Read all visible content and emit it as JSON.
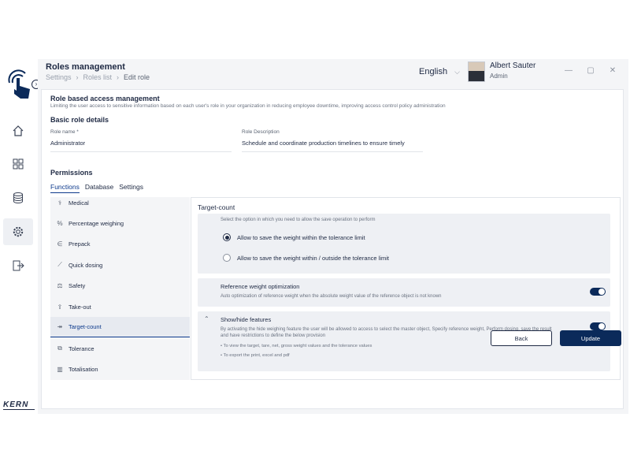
{
  "header": {
    "title": "Roles management",
    "breadcrumb": [
      "Settings",
      "Roles list",
      "Edit role"
    ],
    "language": "English",
    "user_name": "Albert Sauter",
    "user_role": "Admin"
  },
  "brand": {
    "logo_text": "KERN"
  },
  "section": {
    "title": "Role based access management",
    "subtitle": "Limiting the user access to sensitive information based on each user's role in your organization in reducing employee downtime, improving access control policy administration"
  },
  "basic": {
    "title": "Basic role details",
    "role_name_label": "Role name *",
    "role_name_value": "Administrator",
    "role_desc_label": "Role Description",
    "role_desc_value": "Schedule and coordinate production timelines to ensure timely"
  },
  "permissions": {
    "title": "Permissions",
    "tabs": [
      "Functions",
      "Database",
      "Settings"
    ]
  },
  "functions": [
    {
      "label": "Medical",
      "icon": "medical-icon"
    },
    {
      "label": "Percentage weighing",
      "icon": "percent-icon"
    },
    {
      "label": "Prepack",
      "icon": "prepack-icon"
    },
    {
      "label": "Quick dosing",
      "icon": "pipette-icon"
    },
    {
      "label": "Safety",
      "icon": "safety-icon"
    },
    {
      "label": "Take-out",
      "icon": "takeout-icon"
    },
    {
      "label": "Target-count",
      "icon": "target-count-icon"
    },
    {
      "label": "Tolerance",
      "icon": "tolerance-icon"
    },
    {
      "label": "Totalisation",
      "icon": "totalisation-icon"
    }
  ],
  "pane": {
    "title": "Target-count",
    "save_hint": "Select the option in which you need to allow the save operation to perform",
    "radio_within": "Allow to save the weight within the tolerance limit",
    "radio_within_outside": "Allow to save the weight within / outside the tolerance limit",
    "ref_title": "Reference weight optimization",
    "ref_desc": "Auto optimization of reference weight when the absolute weight value of the reference object is not known",
    "show_title": "Show/hide features",
    "show_desc_1": "By activating the hide weighing feature the user will be allowed to access to select the master object, Specify reference weight, Perform dosing, save the result",
    "show_desc_2": "and have restrictions to define the below provision",
    "bullet_1": "To view the target, tare, net, gross weight values and the tolerance values",
    "bullet_2": "To export the print, excel and pdf"
  },
  "actions": {
    "back": "Back",
    "update": "Update"
  },
  "colors": {
    "accent": "#0b2a5a",
    "link": "#0d3a8c"
  }
}
